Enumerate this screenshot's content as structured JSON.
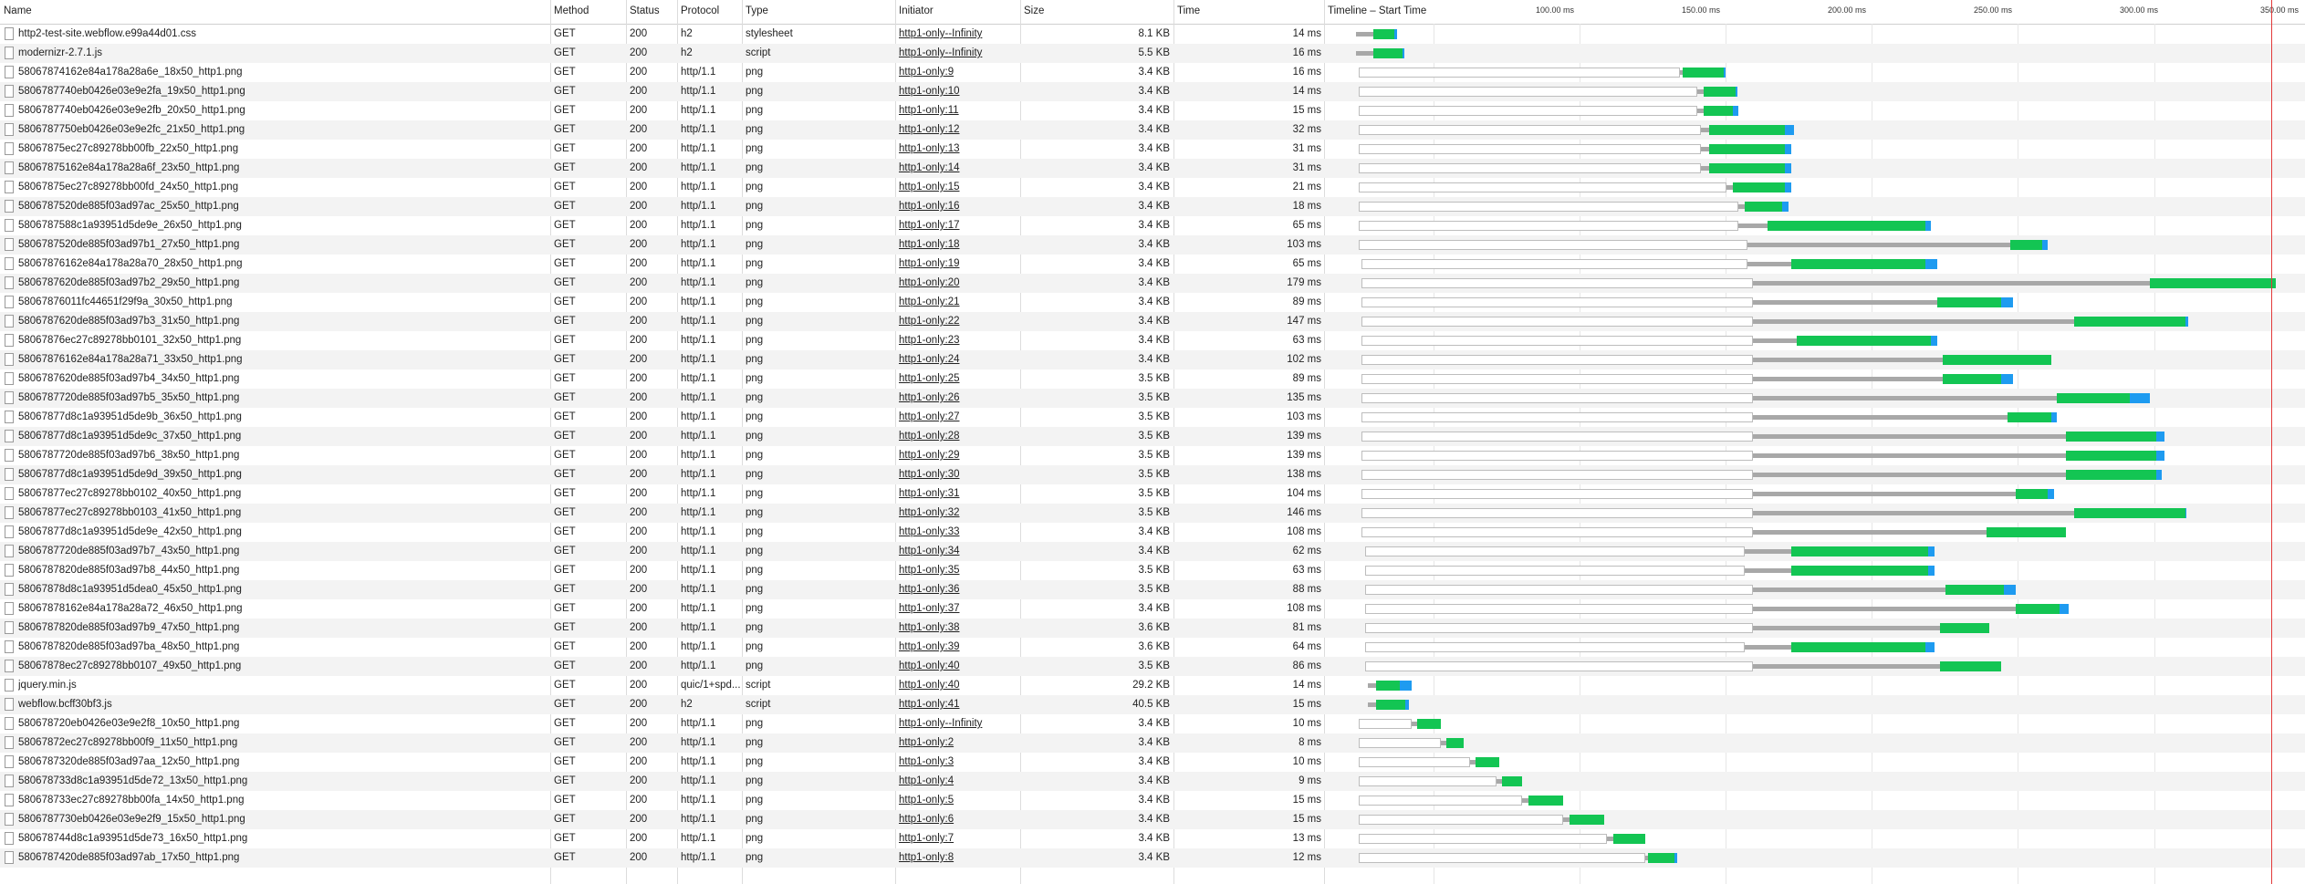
{
  "columns": {
    "name": "Name",
    "method": "Method",
    "status": "Status",
    "protocol": "Protocol",
    "type": "Type",
    "initiator": "Initiator",
    "size": "Size",
    "time": "Time",
    "timeline": "Timeline – Start Time"
  },
  "timeline_ticks": [
    "100.00 ms",
    "150.00 ms",
    "200.00 ms",
    "250.00 ms",
    "300.00 ms",
    "350.00 ms"
  ],
  "legend_colors": {
    "queue": "#a8a8a8",
    "receiving": "#13c553",
    "content_download": "#1e9bf0",
    "marker": "#e23a3a"
  },
  "requests": [
    {
      "name": "http2-test-site.webflow.e99a44d01.css",
      "method": "GET",
      "status": "200",
      "protocol": "h2",
      "type": "stylesheet",
      "initiator": "http1-only--Infinity",
      "size": "8.1 KB",
      "time": "14 ms",
      "start": 0,
      "wait": 0,
      "queue": 6,
      "recv": 7,
      "dl": 1
    },
    {
      "name": "modernizr-2.7.1.js",
      "method": "GET",
      "status": "200",
      "protocol": "h2",
      "type": "script",
      "initiator": "http1-only--Infinity",
      "size": "5.5 KB",
      "time": "16 ms",
      "start": 0,
      "wait": 0,
      "queue": 6,
      "recv": 10,
      "dl": 0.5
    },
    {
      "name": "58067874162e84a178a28a6e_18x50_http1.png",
      "method": "GET",
      "status": "200",
      "protocol": "http/1.1",
      "type": "png",
      "initiator": "http1-only:9",
      "size": "3.4 KB",
      "time": "16 ms",
      "start": 1,
      "wait": 110,
      "queue": 1,
      "recv": 14,
      "dl": 0.5
    },
    {
      "name": "5806787740eb0426e03e9e2fa_19x50_http1.png",
      "method": "GET",
      "status": "200",
      "protocol": "http/1.1",
      "type": "png",
      "initiator": "http1-only:10",
      "size": "3.4 KB",
      "time": "14 ms",
      "start": 1,
      "wait": 116,
      "queue": 2,
      "recv": 11,
      "dl": 0.5
    },
    {
      "name": "5806787740eb0426e03e9e2fb_20x50_http1.png",
      "method": "GET",
      "status": "200",
      "protocol": "http/1.1",
      "type": "png",
      "initiator": "http1-only:11",
      "size": "3.4 KB",
      "time": "15 ms",
      "start": 1,
      "wait": 116,
      "queue": 2,
      "recv": 10,
      "dl": 2
    },
    {
      "name": "5806787750eb0426e03e9e2fc_21x50_http1.png",
      "method": "GET",
      "status": "200",
      "protocol": "http/1.1",
      "type": "png",
      "initiator": "http1-only:12",
      "size": "3.4 KB",
      "time": "32 ms",
      "start": 1,
      "wait": 117,
      "queue": 3,
      "recv": 26,
      "dl": 3
    },
    {
      "name": "58067875ec27c89278bb00fb_22x50_http1.png",
      "method": "GET",
      "status": "200",
      "protocol": "http/1.1",
      "type": "png",
      "initiator": "http1-only:13",
      "size": "3.4 KB",
      "time": "31 ms",
      "start": 1,
      "wait": 117,
      "queue": 3,
      "recv": 26,
      "dl": 2
    },
    {
      "name": "58067875162e84a178a28a6f_23x50_http1.png",
      "method": "GET",
      "status": "200",
      "protocol": "http/1.1",
      "type": "png",
      "initiator": "http1-only:14",
      "size": "3.4 KB",
      "time": "31 ms",
      "start": 1,
      "wait": 117,
      "queue": 3,
      "recv": 26,
      "dl": 2
    },
    {
      "name": "58067875ec27c89278bb00fd_24x50_http1.png",
      "method": "GET",
      "status": "200",
      "protocol": "http/1.1",
      "type": "png",
      "initiator": "http1-only:15",
      "size": "3.4 KB",
      "time": "21 ms",
      "start": 1,
      "wait": 126,
      "queue": 2,
      "recv": 18,
      "dl": 2
    },
    {
      "name": "5806787520de885f03ad97ac_25x50_http1.png",
      "method": "GET",
      "status": "200",
      "protocol": "http/1.1",
      "type": "png",
      "initiator": "http1-only:16",
      "size": "3.4 KB",
      "time": "18 ms",
      "start": 1,
      "wait": 130,
      "queue": 2,
      "recv": 13,
      "dl": 2
    },
    {
      "name": "5806787588c1a93951d5de9e_26x50_http1.png",
      "method": "GET",
      "status": "200",
      "protocol": "http/1.1",
      "type": "png",
      "initiator": "http1-only:17",
      "size": "3.4 KB",
      "time": "65 ms",
      "start": 1,
      "wait": 130,
      "queue": 10,
      "recv": 54,
      "dl": 2
    },
    {
      "name": "5806787520de885f03ad97b1_27x50_http1.png",
      "method": "GET",
      "status": "200",
      "protocol": "http/1.1",
      "type": "png",
      "initiator": "http1-only:18",
      "size": "3.4 KB",
      "time": "103 ms",
      "start": 1,
      "wait": 133,
      "queue": 90,
      "recv": 11,
      "dl": 2
    },
    {
      "name": "58067876162e84a178a28a70_28x50_http1.png",
      "method": "GET",
      "status": "200",
      "protocol": "http/1.1",
      "type": "png",
      "initiator": "http1-only:19",
      "size": "3.4 KB",
      "time": "65 ms",
      "start": 2,
      "wait": 132,
      "queue": 15,
      "recv": 46,
      "dl": 4
    },
    {
      "name": "5806787620de885f03ad97b2_29x50_http1.png",
      "method": "GET",
      "status": "200",
      "protocol": "http/1.1",
      "type": "png",
      "initiator": "http1-only:20",
      "size": "3.4 KB",
      "time": "179 ms",
      "start": 2,
      "wait": 134,
      "queue": 136,
      "recv": 43,
      "dl": 0
    },
    {
      "name": "58067876011fc44651f29f9a_30x50_http1.png",
      "method": "GET",
      "status": "200",
      "protocol": "http/1.1",
      "type": "png",
      "initiator": "http1-only:21",
      "size": "3.4 KB",
      "time": "89 ms",
      "start": 2,
      "wait": 134,
      "queue": 63,
      "recv": 22,
      "dl": 4
    },
    {
      "name": "5806787620de885f03ad97b3_31x50_http1.png",
      "method": "GET",
      "status": "200",
      "protocol": "http/1.1",
      "type": "png",
      "initiator": "http1-only:22",
      "size": "3.4 KB",
      "time": "147 ms",
      "start": 2,
      "wait": 134,
      "queue": 110,
      "recv": 38,
      "dl": 1
    },
    {
      "name": "58067876ec27c89278bb0101_32x50_http1.png",
      "method": "GET",
      "status": "200",
      "protocol": "http/1.1",
      "type": "png",
      "initiator": "http1-only:23",
      "size": "3.4 KB",
      "time": "63 ms",
      "start": 2,
      "wait": 134,
      "queue": 15,
      "recv": 46,
      "dl": 2
    },
    {
      "name": "58067876162e84a178a28a71_33x50_http1.png",
      "method": "GET",
      "status": "200",
      "protocol": "http/1.1",
      "type": "png",
      "initiator": "http1-only:24",
      "size": "3.4 KB",
      "time": "102 ms",
      "start": 2,
      "wait": 134,
      "queue": 65,
      "recv": 37,
      "dl": 0
    },
    {
      "name": "5806787620de885f03ad97b4_34x50_http1.png",
      "method": "GET",
      "status": "200",
      "protocol": "http/1.1",
      "type": "png",
      "initiator": "http1-only:25",
      "size": "3.5 KB",
      "time": "89 ms",
      "start": 2,
      "wait": 134,
      "queue": 65,
      "recv": 20,
      "dl": 4
    },
    {
      "name": "5806787720de885f03ad97b5_35x50_http1.png",
      "method": "GET",
      "status": "200",
      "protocol": "http/1.1",
      "type": "png",
      "initiator": "http1-only:26",
      "size": "3.5 KB",
      "time": "135 ms",
      "start": 2,
      "wait": 134,
      "queue": 104,
      "recv": 25,
      "dl": 7
    },
    {
      "name": "58067877d8c1a93951d5de9b_36x50_http1.png",
      "method": "GET",
      "status": "200",
      "protocol": "http/1.1",
      "type": "png",
      "initiator": "http1-only:27",
      "size": "3.5 KB",
      "time": "103 ms",
      "start": 2,
      "wait": 134,
      "queue": 87,
      "recv": 15,
      "dl": 2
    },
    {
      "name": "58067877d8c1a93951d5de9c_37x50_http1.png",
      "method": "GET",
      "status": "200",
      "protocol": "http/1.1",
      "type": "png",
      "initiator": "http1-only:28",
      "size": "3.5 KB",
      "time": "139 ms",
      "start": 2,
      "wait": 134,
      "queue": 107,
      "recv": 31,
      "dl": 3
    },
    {
      "name": "5806787720de885f03ad97b6_38x50_http1.png",
      "method": "GET",
      "status": "200",
      "protocol": "http/1.1",
      "type": "png",
      "initiator": "http1-only:29",
      "size": "3.5 KB",
      "time": "139 ms",
      "start": 2,
      "wait": 134,
      "queue": 107,
      "recv": 31,
      "dl": 3
    },
    {
      "name": "58067877d8c1a93951d5de9d_39x50_http1.png",
      "method": "GET",
      "status": "200",
      "protocol": "http/1.1",
      "type": "png",
      "initiator": "http1-only:30",
      "size": "3.5 KB",
      "time": "138 ms",
      "start": 2,
      "wait": 134,
      "queue": 107,
      "recv": 31,
      "dl": 2
    },
    {
      "name": "58067877ec27c89278bb0102_40x50_http1.png",
      "method": "GET",
      "status": "200",
      "protocol": "http/1.1",
      "type": "png",
      "initiator": "http1-only:31",
      "size": "3.5 KB",
      "time": "104 ms",
      "start": 2,
      "wait": 134,
      "queue": 90,
      "recv": 11,
      "dl": 2
    },
    {
      "name": "58067877ec27c89278bb0103_41x50_http1.png",
      "method": "GET",
      "status": "200",
      "protocol": "http/1.1",
      "type": "png",
      "initiator": "http1-only:32",
      "size": "3.5 KB",
      "time": "146 ms",
      "start": 2,
      "wait": 134,
      "queue": 110,
      "recv": 38,
      "dl": 0.5
    },
    {
      "name": "58067877d8c1a93951d5de9e_42x50_http1.png",
      "method": "GET",
      "status": "200",
      "protocol": "http/1.1",
      "type": "png",
      "initiator": "http1-only:33",
      "size": "3.4 KB",
      "time": "108 ms",
      "start": 2,
      "wait": 134,
      "queue": 80,
      "recv": 27,
      "dl": 0
    },
    {
      "name": "5806787720de885f03ad97b7_43x50_http1.png",
      "method": "GET",
      "status": "200",
      "protocol": "http/1.1",
      "type": "png",
      "initiator": "http1-only:34",
      "size": "3.4 KB",
      "time": "62 ms",
      "start": 3,
      "wait": 130,
      "queue": 16,
      "recv": 47,
      "dl": 2
    },
    {
      "name": "5806787820de885f03ad97b8_44x50_http1.png",
      "method": "GET",
      "status": "200",
      "protocol": "http/1.1",
      "type": "png",
      "initiator": "http1-only:35",
      "size": "3.5 KB",
      "time": "63 ms",
      "start": 3,
      "wait": 130,
      "queue": 16,
      "recv": 47,
      "dl": 2
    },
    {
      "name": "58067878d8c1a93951d5dea0_45x50_http1.png",
      "method": "GET",
      "status": "200",
      "protocol": "http/1.1",
      "type": "png",
      "initiator": "http1-only:36",
      "size": "3.5 KB",
      "time": "88 ms",
      "start": 3,
      "wait": 133,
      "queue": 66,
      "recv": 20,
      "dl": 4
    },
    {
      "name": "58067878162e84a178a28a72_46x50_http1.png",
      "method": "GET",
      "status": "200",
      "protocol": "http/1.1",
      "type": "png",
      "initiator": "http1-only:37",
      "size": "3.4 KB",
      "time": "108 ms",
      "start": 3,
      "wait": 133,
      "queue": 90,
      "recv": 15,
      "dl": 3
    },
    {
      "name": "5806787820de885f03ad97b9_47x50_http1.png",
      "method": "GET",
      "status": "200",
      "protocol": "http/1.1",
      "type": "png",
      "initiator": "http1-only:38",
      "size": "3.6 KB",
      "time": "81 ms",
      "start": 3,
      "wait": 133,
      "queue": 64,
      "recv": 17,
      "dl": 0
    },
    {
      "name": "5806787820de885f03ad97ba_48x50_http1.png",
      "method": "GET",
      "status": "200",
      "protocol": "http/1.1",
      "type": "png",
      "initiator": "http1-only:39",
      "size": "3.6 KB",
      "time": "64 ms",
      "start": 3,
      "wait": 130,
      "queue": 16,
      "recv": 46,
      "dl": 3
    },
    {
      "name": "58067878ec27c89278bb0107_49x50_http1.png",
      "method": "GET",
      "status": "200",
      "protocol": "http/1.1",
      "type": "png",
      "initiator": "http1-only:40",
      "size": "3.5 KB",
      "time": "86 ms",
      "start": 3,
      "wait": 133,
      "queue": 64,
      "recv": 21,
      "dl": 0
    },
    {
      "name": "jquery.min.js",
      "method": "GET",
      "status": "200",
      "protocol": "quic/1+spd...",
      "type": "script",
      "initiator": "http1-only:40",
      "size": "29.2 KB",
      "time": "14 ms",
      "start": 4,
      "wait": 0,
      "queue": 3,
      "recv": 8,
      "dl": 4
    },
    {
      "name": "webflow.bcff30bf3.js",
      "method": "GET",
      "status": "200",
      "protocol": "h2",
      "type": "script",
      "initiator": "http1-only:41",
      "size": "40.5 KB",
      "time": "15 ms",
      "start": 4,
      "wait": 0,
      "queue": 3,
      "recv": 10,
      "dl": 1
    },
    {
      "name": "580678720eb0426e03e9e2f8_10x50_http1.png",
      "method": "GET",
      "status": "200",
      "protocol": "http/1.1",
      "type": "png",
      "initiator": "http1-only--Infinity",
      "size": "3.4 KB",
      "time": "10 ms",
      "start": 1,
      "wait": 18,
      "queue": 2,
      "recv": 8,
      "dl": 0
    },
    {
      "name": "58067872ec27c89278bb00f9_11x50_http1.png",
      "method": "GET",
      "status": "200",
      "protocol": "http/1.1",
      "type": "png",
      "initiator": "http1-only:2",
      "size": "3.4 KB",
      "time": "8 ms",
      "start": 1,
      "wait": 28,
      "queue": 2,
      "recv": 6,
      "dl": 0
    },
    {
      "name": "5806787320de885f03ad97aa_12x50_http1.png",
      "method": "GET",
      "status": "200",
      "protocol": "http/1.1",
      "type": "png",
      "initiator": "http1-only:3",
      "size": "3.4 KB",
      "time": "10 ms",
      "start": 1,
      "wait": 38,
      "queue": 2,
      "recv": 8,
      "dl": 0
    },
    {
      "name": "580678733d8c1a93951d5de72_13x50_http1.png",
      "method": "GET",
      "status": "200",
      "protocol": "http/1.1",
      "type": "png",
      "initiator": "http1-only:4",
      "size": "3.4 KB",
      "time": "9 ms",
      "start": 1,
      "wait": 47,
      "queue": 2,
      "recv": 7,
      "dl": 0
    },
    {
      "name": "580678733ec27c89278bb00fa_14x50_http1.png",
      "method": "GET",
      "status": "200",
      "protocol": "http/1.1",
      "type": "png",
      "initiator": "http1-only:5",
      "size": "3.4 KB",
      "time": "15 ms",
      "start": 1,
      "wait": 56,
      "queue": 2,
      "recv": 12,
      "dl": 0
    },
    {
      "name": "5806787730eb0426e03e9e2f9_15x50_http1.png",
      "method": "GET",
      "status": "200",
      "protocol": "http/1.1",
      "type": "png",
      "initiator": "http1-only:6",
      "size": "3.4 KB",
      "time": "15 ms",
      "start": 1,
      "wait": 70,
      "queue": 2,
      "recv": 12,
      "dl": 0
    },
    {
      "name": "580678744d8c1a93951d5de73_16x50_http1.png",
      "method": "GET",
      "status": "200",
      "protocol": "http/1.1",
      "type": "png",
      "initiator": "http1-only:7",
      "size": "3.4 KB",
      "time": "13 ms",
      "start": 1,
      "wait": 85,
      "queue": 2,
      "recv": 11,
      "dl": 0
    },
    {
      "name": "5806787420de885f03ad97ab_17x50_http1.png",
      "method": "GET",
      "status": "200",
      "protocol": "http/1.1",
      "type": "png",
      "initiator": "http1-only:8",
      "size": "3.4 KB",
      "time": "12 ms",
      "start": 1,
      "wait": 98,
      "queue": 1,
      "recv": 9,
      "dl": 1
    }
  ]
}
